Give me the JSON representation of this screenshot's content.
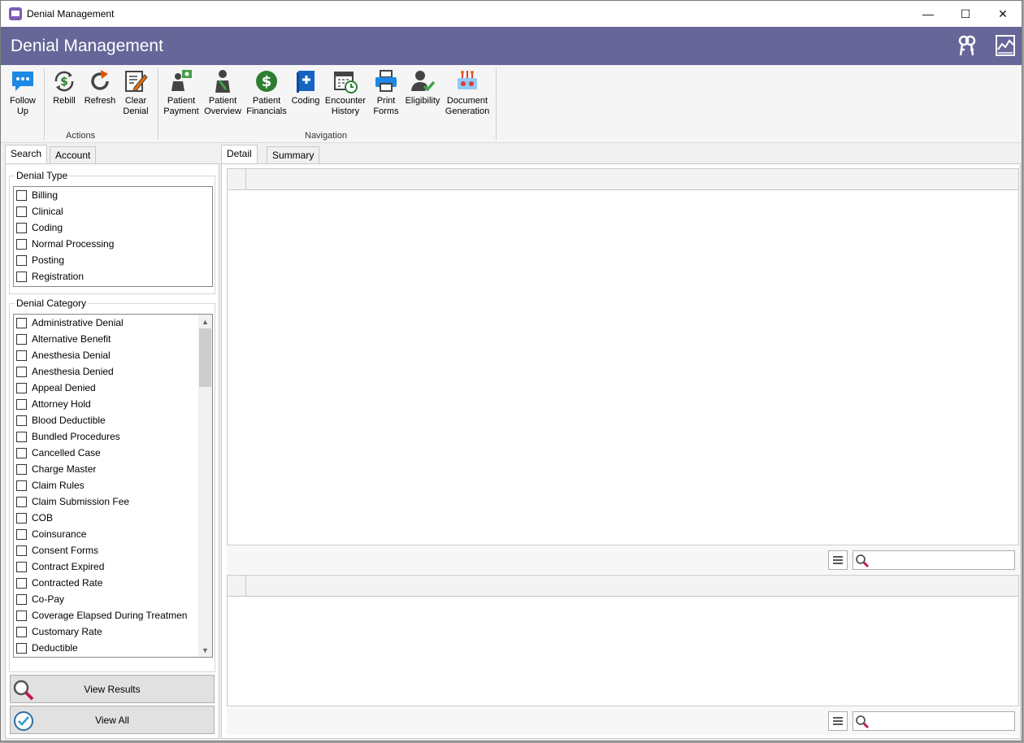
{
  "window": {
    "title": "Denial Management",
    "controls": [
      "—",
      "☐",
      "✕"
    ]
  },
  "header": {
    "title": "Denial Management",
    "icons": [
      "keys-icon",
      "chart-document-icon"
    ]
  },
  "ribbon": {
    "groups": [
      {
        "label": "Actions",
        "buttons": [
          "Follow Up",
          "Rebill",
          "Refresh",
          "Clear Denial"
        ]
      },
      {
        "label": "Navigation",
        "buttons": [
          "Patient Payment",
          "Patient Overview",
          "Patient Financials",
          "Coding",
          "Encounter History",
          "Print Forms",
          "Eligibility",
          "Document Generation"
        ]
      }
    ],
    "buttons": {
      "follow_up": [
        "Follow",
        "Up"
      ],
      "rebill": [
        "Rebill"
      ],
      "refresh": [
        "Refresh"
      ],
      "clear_denial": [
        "Clear",
        "Denial"
      ],
      "patient_payment": [
        "Patient",
        "Payment"
      ],
      "patient_overview": [
        "Patient",
        "Overview"
      ],
      "patient_financials": [
        "Patient",
        "Financials"
      ],
      "coding": [
        "Coding"
      ],
      "encounter_history": [
        "Encounter",
        "History"
      ],
      "print_forms": [
        "Print",
        "Forms"
      ],
      "eligibility": [
        "Eligibility"
      ],
      "document_generation": [
        "Document",
        "Generation"
      ]
    },
    "group_labels": {
      "actions": "Actions",
      "navigation": "Navigation"
    }
  },
  "left_tabs": {
    "search": "Search",
    "account": "Account"
  },
  "denial_type": {
    "legend": "Denial Type",
    "items": [
      "Billing",
      "Clinical",
      "Coding",
      "Normal Processing",
      "Posting",
      "Registration"
    ]
  },
  "denial_category": {
    "legend": "Denial Category",
    "items": [
      "Administrative Denial",
      "Alternative Benefit",
      "Anesthesia Denial",
      "Anesthesia Denied",
      "Appeal Denied",
      "Attorney Hold",
      "Blood Deductible",
      "Bundled Procedures",
      "Cancelled Case",
      "Charge Master",
      "Claim Rules",
      "Claim Submission Fee",
      "COB",
      "Coinsurance",
      "Consent Forms",
      "Contract Expired",
      "Contracted Rate",
      "Co-Pay",
      "Coverage Elapsed During Treatmen",
      "Customary Rate",
      "Deductible"
    ]
  },
  "buttons": {
    "view_results": "View Results",
    "view_all": "View All"
  },
  "right_tabs": {
    "detail": "Detail",
    "summary": "Summary"
  },
  "search_placeholder": ""
}
